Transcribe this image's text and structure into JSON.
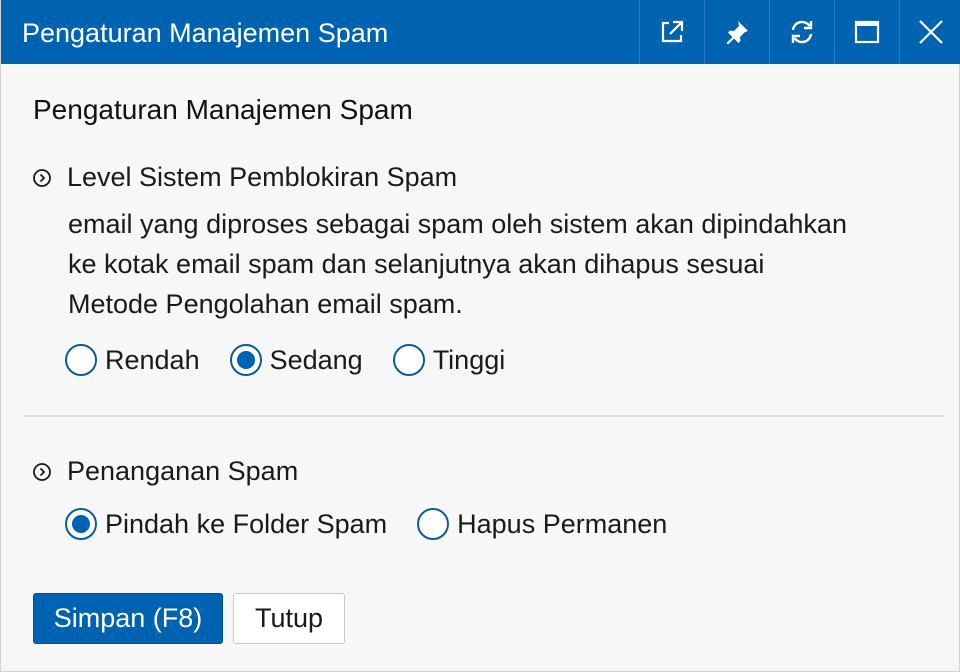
{
  "window": {
    "title": "Pengaturan Manajemen Spam",
    "controls": [
      "external-link-icon",
      "pin-icon",
      "refresh-icon",
      "maximize-icon",
      "close-icon"
    ],
    "accent_color": "#0063b1"
  },
  "main": {
    "heading": "Pengaturan Manajemen Spam",
    "spam_level": {
      "title": "Level Sistem Pemblokiran Spam",
      "description_lines": [
        "email yang diproses sebagai spam oleh sistem akan dipindahkan",
        "ke kotak email spam dan selanjutnya akan dihapus sesuai",
        "Metode Pengolahan email spam."
      ],
      "options": [
        "Rendah",
        "Sedang",
        "Tinggi"
      ],
      "selected": "Sedang"
    },
    "spam_handling": {
      "title": "Penanganan Spam",
      "options": [
        "Pindah ke Folder Spam",
        "Hapus Permanen"
      ],
      "selected": "Pindah ke Folder Spam"
    }
  },
  "footer": {
    "save_label": "Simpan (F8)",
    "close_label": "Tutup"
  }
}
